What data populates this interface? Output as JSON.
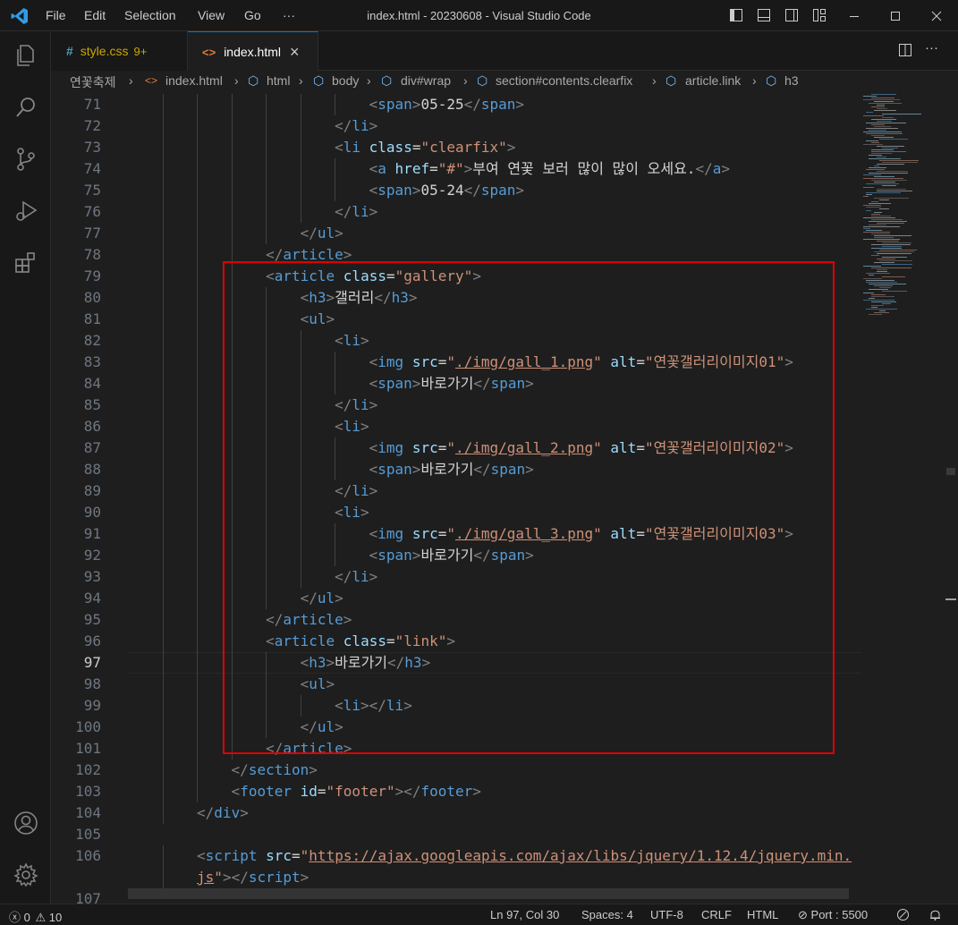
{
  "window": {
    "title": "index.html - 20230608 - Visual Studio Code"
  },
  "menu": [
    "File",
    "Edit",
    "Selection",
    "View",
    "Go",
    "···"
  ],
  "tabs": [
    {
      "icon": "#",
      "label": "style.css",
      "badge": "9+",
      "active": false
    },
    {
      "icon": "<>",
      "label": "index.html",
      "close": "×",
      "active": true
    }
  ],
  "breadcrumb": [
    "연꽃축제",
    "index.html",
    "html",
    "body",
    "div#wrap",
    "section#contents.clearfix",
    "article.link",
    "h3"
  ],
  "editor": {
    "current_line": 97,
    "lines": [
      {
        "n": "71",
        "indent": 7,
        "tokens": [
          [
            "b",
            "<"
          ],
          [
            "t",
            "span"
          ],
          [
            "b",
            ">"
          ],
          [
            "p",
            "05-25"
          ],
          [
            "b",
            "</"
          ],
          [
            "t",
            "span"
          ],
          [
            "b",
            ">"
          ]
        ]
      },
      {
        "n": "72",
        "indent": 6,
        "tokens": [
          [
            "b",
            "</"
          ],
          [
            "t",
            "li"
          ],
          [
            "b",
            ">"
          ]
        ]
      },
      {
        "n": "73",
        "indent": 6,
        "tokens": [
          [
            "b",
            "<"
          ],
          [
            "t",
            "li"
          ],
          [
            "p",
            " "
          ],
          [
            "a",
            "class"
          ],
          [
            "p",
            "="
          ],
          [
            "s",
            "\"clearfix\""
          ],
          [
            "b",
            ">"
          ]
        ]
      },
      {
        "n": "74",
        "indent": 7,
        "tokens": [
          [
            "b",
            "<"
          ],
          [
            "t",
            "a"
          ],
          [
            "p",
            " "
          ],
          [
            "a",
            "href"
          ],
          [
            "p",
            "="
          ],
          [
            "s",
            "\"#\""
          ],
          [
            "b",
            ">"
          ],
          [
            "p",
            "부여 연꽃 보러 많이 많이 오세요."
          ],
          [
            "b",
            "</"
          ],
          [
            "t",
            "a"
          ],
          [
            "b",
            ">"
          ]
        ]
      },
      {
        "n": "75",
        "indent": 7,
        "tokens": [
          [
            "b",
            "<"
          ],
          [
            "t",
            "span"
          ],
          [
            "b",
            ">"
          ],
          [
            "p",
            "05-24"
          ],
          [
            "b",
            "</"
          ],
          [
            "t",
            "span"
          ],
          [
            "b",
            ">"
          ]
        ]
      },
      {
        "n": "76",
        "indent": 6,
        "tokens": [
          [
            "b",
            "</"
          ],
          [
            "t",
            "li"
          ],
          [
            "b",
            ">"
          ]
        ]
      },
      {
        "n": "77",
        "indent": 5,
        "tokens": [
          [
            "b",
            "</"
          ],
          [
            "t",
            "ul"
          ],
          [
            "b",
            ">"
          ]
        ]
      },
      {
        "n": "78",
        "indent": 4,
        "tokens": [
          [
            "b",
            "</"
          ],
          [
            "t",
            "article"
          ],
          [
            "b",
            ">"
          ]
        ]
      },
      {
        "n": "79",
        "indent": 4,
        "tokens": [
          [
            "b",
            "<"
          ],
          [
            "t",
            "article"
          ],
          [
            "p",
            " "
          ],
          [
            "a",
            "class"
          ],
          [
            "p",
            "="
          ],
          [
            "s",
            "\"gallery\""
          ],
          [
            "b",
            ">"
          ]
        ]
      },
      {
        "n": "80",
        "indent": 5,
        "tokens": [
          [
            "b",
            "<"
          ],
          [
            "t",
            "h3"
          ],
          [
            "b",
            ">"
          ],
          [
            "p",
            "갤러리"
          ],
          [
            "b",
            "</"
          ],
          [
            "t",
            "h3"
          ],
          [
            "b",
            ">"
          ]
        ]
      },
      {
        "n": "81",
        "indent": 5,
        "tokens": [
          [
            "b",
            "<"
          ],
          [
            "t",
            "ul"
          ],
          [
            "b",
            ">"
          ]
        ]
      },
      {
        "n": "82",
        "indent": 6,
        "tokens": [
          [
            "b",
            "<"
          ],
          [
            "t",
            "li"
          ],
          [
            "b",
            ">"
          ]
        ]
      },
      {
        "n": "83",
        "indent": 7,
        "tokens": [
          [
            "b",
            "<"
          ],
          [
            "t",
            "img"
          ],
          [
            "p",
            " "
          ],
          [
            "a",
            "src"
          ],
          [
            "p",
            "="
          ],
          [
            "s",
            "\""
          ],
          [
            "su",
            "./img/gall_1.png"
          ],
          [
            "s",
            "\""
          ],
          [
            "p",
            " "
          ],
          [
            "a",
            "alt"
          ],
          [
            "p",
            "="
          ],
          [
            "s",
            "\"연꽃갤러리이미지01\""
          ],
          [
            "b",
            ">"
          ]
        ]
      },
      {
        "n": "84",
        "indent": 7,
        "tokens": [
          [
            "b",
            "<"
          ],
          [
            "t",
            "span"
          ],
          [
            "b",
            ">"
          ],
          [
            "p",
            "바로가기"
          ],
          [
            "b",
            "</"
          ],
          [
            "t",
            "span"
          ],
          [
            "b",
            ">"
          ]
        ]
      },
      {
        "n": "85",
        "indent": 6,
        "tokens": [
          [
            "b",
            "</"
          ],
          [
            "t",
            "li"
          ],
          [
            "b",
            ">"
          ]
        ]
      },
      {
        "n": "86",
        "indent": 6,
        "tokens": [
          [
            "b",
            "<"
          ],
          [
            "t",
            "li"
          ],
          [
            "b",
            ">"
          ]
        ]
      },
      {
        "n": "87",
        "indent": 7,
        "tokens": [
          [
            "b",
            "<"
          ],
          [
            "t",
            "img"
          ],
          [
            "p",
            " "
          ],
          [
            "a",
            "src"
          ],
          [
            "p",
            "="
          ],
          [
            "s",
            "\""
          ],
          [
            "su",
            "./img/gall_2.png"
          ],
          [
            "s",
            "\""
          ],
          [
            "p",
            " "
          ],
          [
            "a",
            "alt"
          ],
          [
            "p",
            "="
          ],
          [
            "s",
            "\"연꽃갤러리이미지02\""
          ],
          [
            "b",
            ">"
          ]
        ]
      },
      {
        "n": "88",
        "indent": 7,
        "tokens": [
          [
            "b",
            "<"
          ],
          [
            "t",
            "span"
          ],
          [
            "b",
            ">"
          ],
          [
            "p",
            "바로가기"
          ],
          [
            "b",
            "</"
          ],
          [
            "t",
            "span"
          ],
          [
            "b",
            ">"
          ]
        ]
      },
      {
        "n": "89",
        "indent": 6,
        "tokens": [
          [
            "b",
            "</"
          ],
          [
            "t",
            "li"
          ],
          [
            "b",
            ">"
          ]
        ]
      },
      {
        "n": "90",
        "indent": 6,
        "tokens": [
          [
            "b",
            "<"
          ],
          [
            "t",
            "li"
          ],
          [
            "b",
            ">"
          ]
        ]
      },
      {
        "n": "91",
        "indent": 7,
        "tokens": [
          [
            "b",
            "<"
          ],
          [
            "t",
            "img"
          ],
          [
            "p",
            " "
          ],
          [
            "a",
            "src"
          ],
          [
            "p",
            "="
          ],
          [
            "s",
            "\""
          ],
          [
            "su",
            "./img/gall_3.png"
          ],
          [
            "s",
            "\""
          ],
          [
            "p",
            " "
          ],
          [
            "a",
            "alt"
          ],
          [
            "p",
            "="
          ],
          [
            "s",
            "\"연꽃갤러리이미지03\""
          ],
          [
            "b",
            ">"
          ]
        ]
      },
      {
        "n": "92",
        "indent": 7,
        "tokens": [
          [
            "b",
            "<"
          ],
          [
            "t",
            "span"
          ],
          [
            "b",
            ">"
          ],
          [
            "p",
            "바로가기"
          ],
          [
            "b",
            "</"
          ],
          [
            "t",
            "span"
          ],
          [
            "b",
            ">"
          ]
        ]
      },
      {
        "n": "93",
        "indent": 6,
        "tokens": [
          [
            "b",
            "</"
          ],
          [
            "t",
            "li"
          ],
          [
            "b",
            ">"
          ]
        ]
      },
      {
        "n": "94",
        "indent": 5,
        "tokens": [
          [
            "b",
            "</"
          ],
          [
            "t",
            "ul"
          ],
          [
            "b",
            ">"
          ]
        ]
      },
      {
        "n": "95",
        "indent": 4,
        "tokens": [
          [
            "b",
            "</"
          ],
          [
            "t",
            "article"
          ],
          [
            "b",
            ">"
          ]
        ]
      },
      {
        "n": "96",
        "indent": 4,
        "tokens": [
          [
            "b",
            "<"
          ],
          [
            "t",
            "article"
          ],
          [
            "p",
            " "
          ],
          [
            "a",
            "class"
          ],
          [
            "p",
            "="
          ],
          [
            "s",
            "\"link\""
          ],
          [
            "b",
            ">"
          ]
        ]
      },
      {
        "n": "97",
        "indent": 5,
        "tokens": [
          [
            "b",
            "<"
          ],
          [
            "t",
            "h3"
          ],
          [
            "b",
            ">"
          ],
          [
            "p",
            "바로가기"
          ],
          [
            "b",
            "</"
          ],
          [
            "t",
            "h3"
          ],
          [
            "b",
            ">"
          ]
        ]
      },
      {
        "n": "98",
        "indent": 5,
        "tokens": [
          [
            "b",
            "<"
          ],
          [
            "t",
            "ul"
          ],
          [
            "b",
            ">"
          ]
        ]
      },
      {
        "n": "99",
        "indent": 6,
        "tokens": [
          [
            "b",
            "<"
          ],
          [
            "t",
            "li"
          ],
          [
            "b",
            "></"
          ],
          [
            "t",
            "li"
          ],
          [
            "b",
            ">"
          ]
        ]
      },
      {
        "n": "100",
        "indent": 5,
        "tokens": [
          [
            "b",
            "</"
          ],
          [
            "t",
            "ul"
          ],
          [
            "b",
            ">"
          ]
        ]
      },
      {
        "n": "101",
        "indent": 4,
        "tokens": [
          [
            "b",
            "</"
          ],
          [
            "t",
            "article"
          ],
          [
            "b",
            ">"
          ]
        ]
      },
      {
        "n": "102",
        "indent": 3,
        "tokens": [
          [
            "b",
            "</"
          ],
          [
            "t",
            "section"
          ],
          [
            "b",
            ">"
          ]
        ]
      },
      {
        "n": "103",
        "indent": 3,
        "tokens": [
          [
            "b",
            "<"
          ],
          [
            "t",
            "footer"
          ],
          [
            "p",
            " "
          ],
          [
            "a",
            "id"
          ],
          [
            "p",
            "="
          ],
          [
            "s",
            "\"footer\""
          ],
          [
            "b",
            "></"
          ],
          [
            "t",
            "footer"
          ],
          [
            "b",
            ">"
          ]
        ]
      },
      {
        "n": "104",
        "indent": 2,
        "tokens": [
          [
            "b",
            "</"
          ],
          [
            "t",
            "div"
          ],
          [
            "b",
            ">"
          ]
        ]
      },
      {
        "n": "105",
        "indent": 0,
        "tokens": []
      },
      {
        "n": "106",
        "indent": 2,
        "tokens": [
          [
            "b",
            "<"
          ],
          [
            "t",
            "script"
          ],
          [
            "p",
            " "
          ],
          [
            "a",
            "src"
          ],
          [
            "p",
            "="
          ],
          [
            "s",
            "\""
          ],
          [
            "su",
            "https://ajax.googleapis.com/ajax/libs/jquery/1.12.4/jquery.min."
          ]
        ]
      },
      {
        "n": "",
        "indent": 2,
        "tokens": [
          [
            "su",
            "js"
          ],
          [
            "s",
            "\""
          ],
          [
            "b",
            "></"
          ],
          [
            "t",
            "script"
          ],
          [
            "b",
            ">"
          ]
        ]
      },
      {
        "n": "107",
        "indent": 0,
        "tokens": []
      }
    ]
  },
  "statusbar": {
    "errors": "0",
    "warnings": "10",
    "position": "Ln 97, Col 30",
    "spaces": "Spaces: 4",
    "encoding": "UTF-8",
    "eol": "CRLF",
    "language": "HTML",
    "port": "Port : 5500"
  },
  "colors": {
    "accent": "#0078d4",
    "tag": "#569cd6",
    "attribute": "#9cdcfe",
    "string": "#ce9178",
    "highlight_box": "#e00000"
  }
}
